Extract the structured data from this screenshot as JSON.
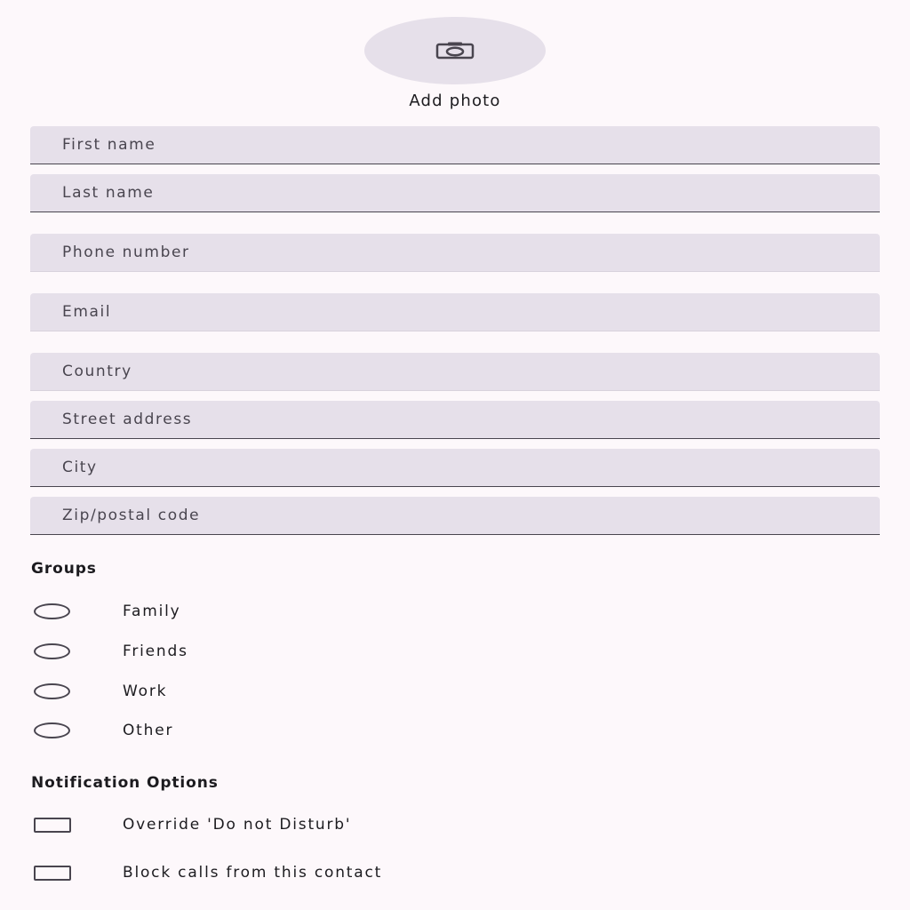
{
  "photo": {
    "icon": "camera-icon",
    "label": "Add photo"
  },
  "fields": {
    "first_name": {
      "placeholder": "First name",
      "value": ""
    },
    "last_name": {
      "placeholder": "Last name",
      "value": ""
    },
    "phone": {
      "placeholder": "Phone number",
      "value": ""
    },
    "email": {
      "placeholder": "Email",
      "value": ""
    },
    "country": {
      "placeholder": "Country",
      "value": ""
    },
    "street": {
      "placeholder": "Street address",
      "value": ""
    },
    "city": {
      "placeholder": "City",
      "value": ""
    },
    "zip": {
      "placeholder": "Zip/postal code",
      "value": ""
    }
  },
  "groups": {
    "title": "Groups",
    "options": [
      {
        "label": "Family",
        "selected": false
      },
      {
        "label": "Friends",
        "selected": false
      },
      {
        "label": "Work",
        "selected": false
      },
      {
        "label": "Other",
        "selected": false
      }
    ]
  },
  "notifications": {
    "title": "Notification Options",
    "options": [
      {
        "label": "Override 'Do not Disturb'",
        "checked": false
      },
      {
        "label": "Block calls from this contact",
        "checked": false
      }
    ]
  },
  "colors": {
    "background": "#fdf8fb",
    "field_fill": "#e6e0ea",
    "outline": "#49454f"
  }
}
